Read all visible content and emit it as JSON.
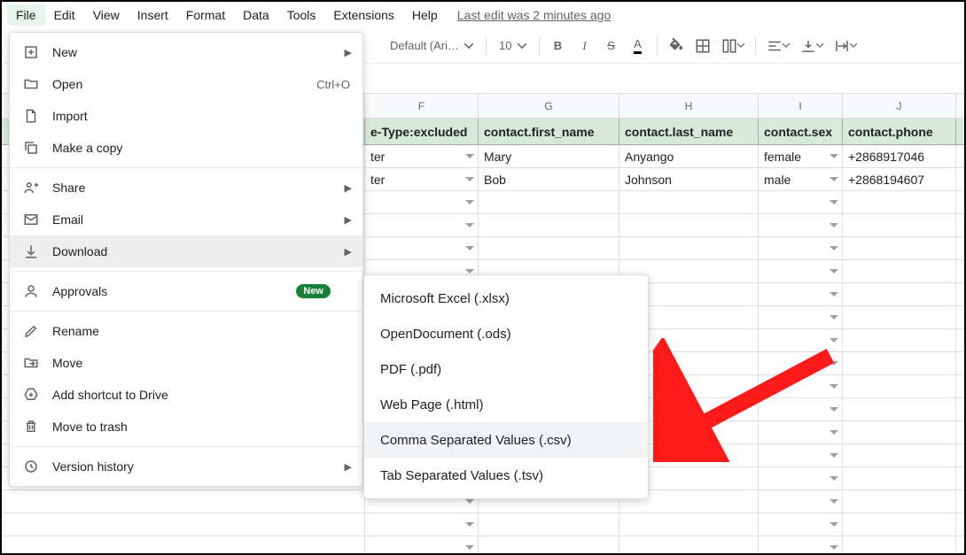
{
  "menubar": {
    "items": [
      "File",
      "Edit",
      "View",
      "Insert",
      "Format",
      "Data",
      "Tools",
      "Extensions",
      "Help"
    ],
    "status": "Last edit was 2 minutes ago"
  },
  "toolbar": {
    "font": "Default (Ari…",
    "fontsize": "10"
  },
  "columns": {
    "letters": [
      "F",
      "G",
      "H",
      "I",
      "J"
    ]
  },
  "headers": {
    "F": "e-Type:excluded",
    "G": "contact.first_name",
    "H": "contact.last_name",
    "I": "contact.sex",
    "J": "contact.phone"
  },
  "rows": [
    {
      "F": "ter",
      "G": "Mary",
      "H": "Anyango",
      "I": "female",
      "J": "+2868917046"
    },
    {
      "F": "ter",
      "G": "Bob",
      "H": "Johnson",
      "I": "male",
      "J": "+2868194607"
    }
  ],
  "fileMenu": {
    "new": "New",
    "open": "Open",
    "openShortcut": "Ctrl+O",
    "import": "Import",
    "copy": "Make a copy",
    "share": "Share",
    "email": "Email",
    "download": "Download",
    "approvals": "Approvals",
    "approvalsBadge": "New",
    "rename": "Rename",
    "move": "Move",
    "shortcut": "Add shortcut to Drive",
    "trash": "Move to trash",
    "history": "Version history"
  },
  "downloadMenu": {
    "xlsx": "Microsoft Excel (.xlsx)",
    "ods": "OpenDocument (.ods)",
    "pdf": "PDF (.pdf)",
    "html": "Web Page (.html)",
    "csv": "Comma Separated Values (.csv)",
    "tsv": "Tab Separated Values (.tsv)"
  }
}
